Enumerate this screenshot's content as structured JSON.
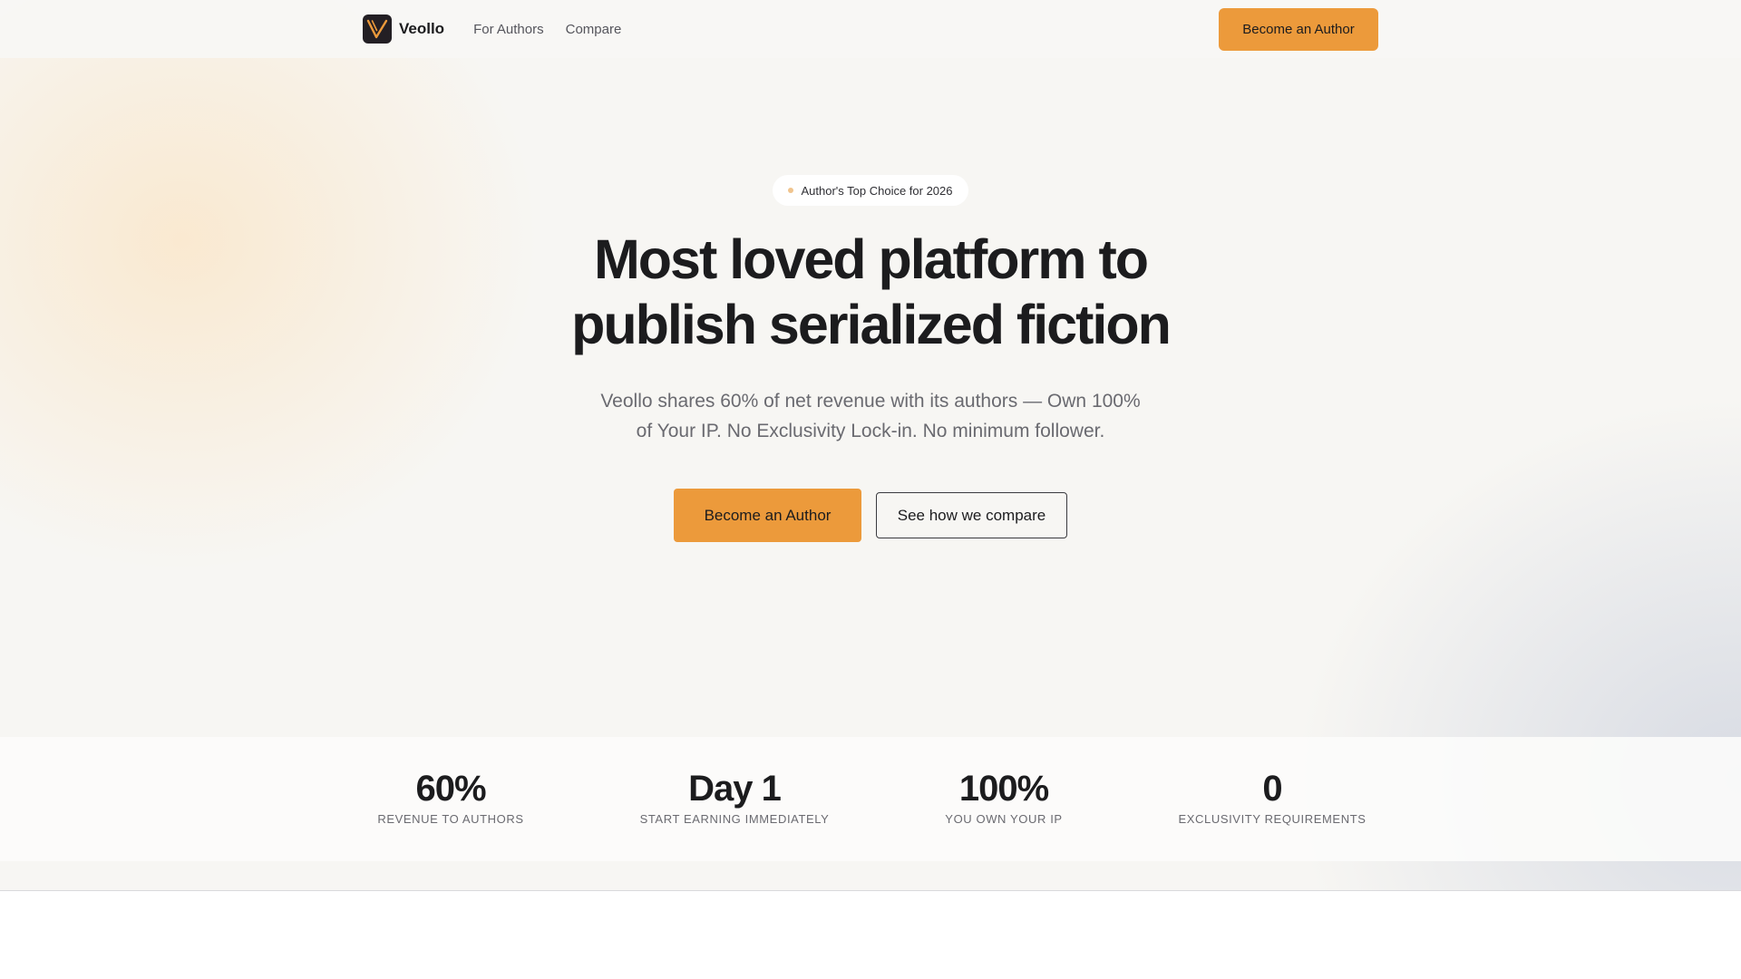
{
  "nav": {
    "brand": "Veollo",
    "logo_icon": "veollo-v-logo",
    "links": [
      "For Authors",
      "Compare"
    ],
    "cta": "Become an Author"
  },
  "hero": {
    "badge": "Author's Top Choice for 2026",
    "title_line1": "Most loved platform to",
    "title_line2": "publish serialized fiction",
    "subtitle": "Veollo shares 60% of net revenue with its authors — Own 100% of Your IP. No Exclusivity Lock-in. No minimum follower.",
    "primary_cta": "Become an Author",
    "secondary_cta": "See how we compare"
  },
  "stats": [
    {
      "value": "60%",
      "label": "REVENUE TO AUTHORS"
    },
    {
      "value": "Day 1",
      "label": "START EARNING IMMEDIATELY"
    },
    {
      "value": "100%",
      "label": "YOU OWN YOUR IP"
    },
    {
      "value": "0",
      "label": "EXCLUSIVITY REQUIREMENTS"
    }
  ],
  "colors": {
    "accent": "#ec9a3b",
    "text": "#1c1c1e",
    "muted": "#6a6a70",
    "logo_bg": "#231f24"
  }
}
